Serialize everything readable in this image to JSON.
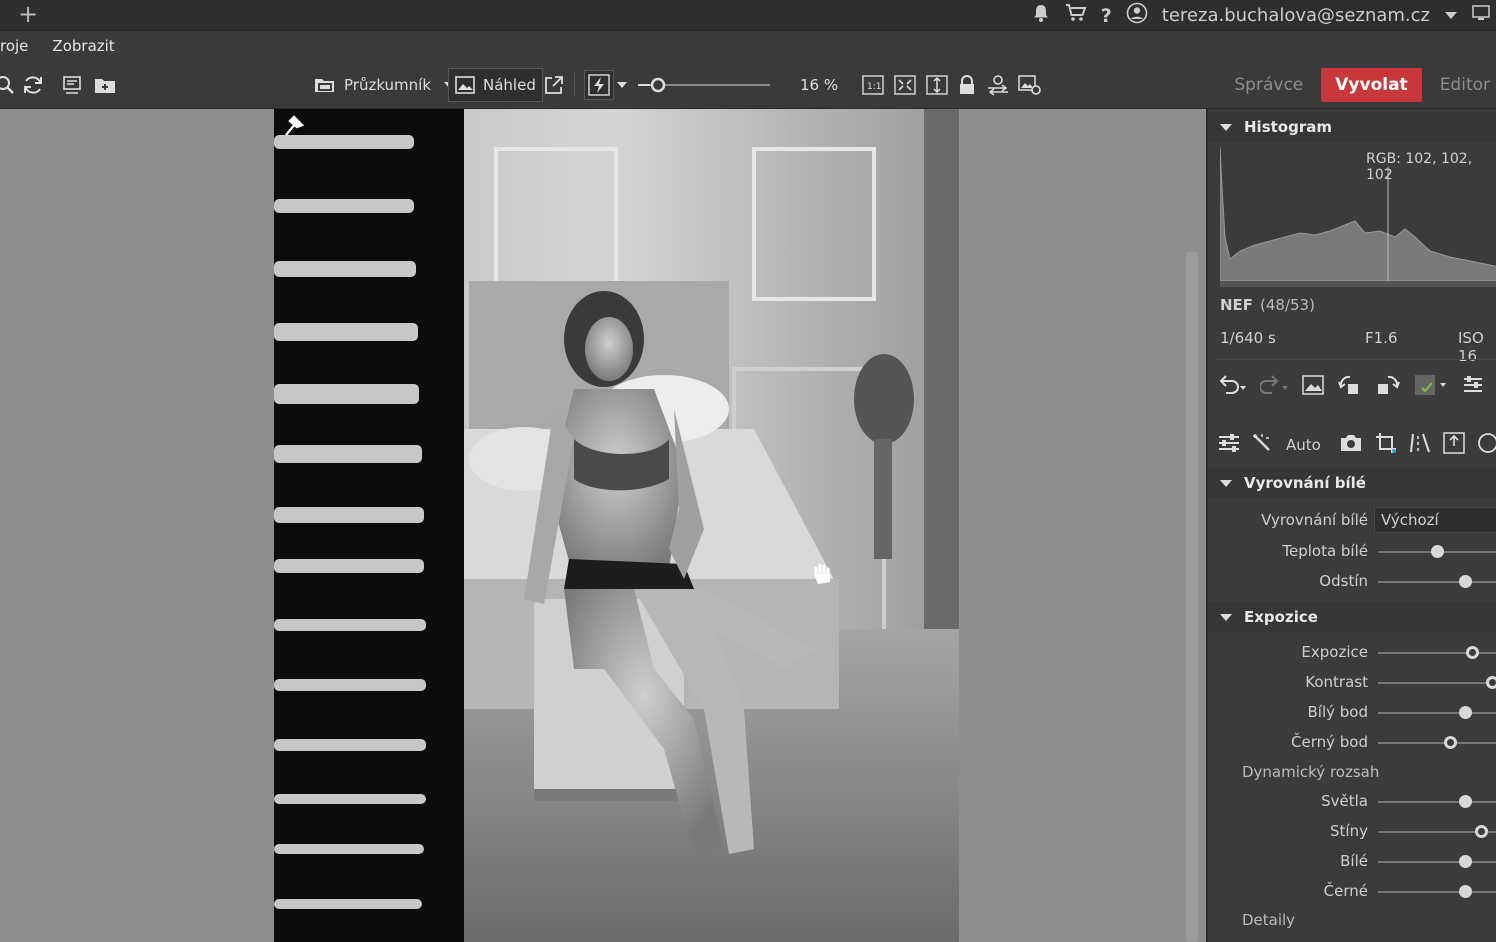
{
  "titlebar": {
    "account_email": "tereza.buchalova@seznam.cz"
  },
  "menu": {
    "items": [
      "roje",
      "Zobrazit"
    ]
  },
  "toolbar": {
    "browser_label": "Průzkumník",
    "preview_label": "Náhled",
    "zoom_value": "16 %",
    "modes": [
      "Správce",
      "Vyvolat",
      "Editor"
    ],
    "active_mode": "Vyvolat"
  },
  "panel": {
    "histogram": {
      "title": "Histogram",
      "rgb_readout": "RGB: 102, 102, 102"
    },
    "file": {
      "format": "NEF",
      "index": "(48/53)",
      "shutter": "1/640 s",
      "aperture": "F1.6",
      "iso": "ISO 16"
    },
    "tools": {
      "auto_label": "Auto"
    },
    "white_balance": {
      "title": "Vyrovnání bílé",
      "mode_label": "Vyrovnání bílé",
      "mode_value": "Výchozí",
      "sliders": [
        {
          "label": "Teplota bílé",
          "value": 0.45,
          "ring": false
        },
        {
          "label": "Odstín",
          "value": 0.67,
          "ring": false
        }
      ]
    },
    "exposure": {
      "title": "Expozice",
      "sliders": [
        {
          "label": "Expozice",
          "value": 0.72,
          "ring": true
        },
        {
          "label": "Kontrast",
          "value": 0.88,
          "ring": true
        },
        {
          "label": "Bílý bod",
          "value": 0.67,
          "ring": false
        },
        {
          "label": "Černý bod",
          "value": 0.55,
          "ring": true
        }
      ],
      "dynamic_range_label": "Dynamický rozsah",
      "range_sliders": [
        {
          "label": "Světla",
          "value": 0.67,
          "ring": false
        },
        {
          "label": "Stíny",
          "value": 0.79,
          "ring": true
        },
        {
          "label": "Bílé",
          "value": 0.67,
          "ring": false
        },
        {
          "label": "Černé",
          "value": 0.67,
          "ring": false
        }
      ],
      "details_label": "Detaily"
    }
  }
}
